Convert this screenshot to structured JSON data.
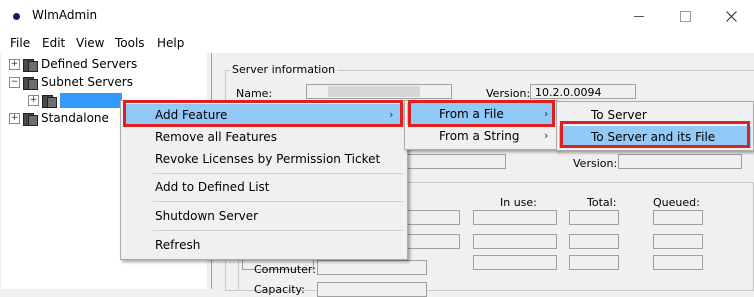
{
  "window": {
    "title": "WlmAdmin"
  },
  "menubar": [
    "File",
    "Edit",
    "View",
    "Tools",
    "Help"
  ],
  "tree": {
    "defined_servers": "Defined Servers",
    "subnet_servers": "Subnet Servers",
    "standalone": "Standalone",
    "expander": "+"
  },
  "server_info": {
    "group_label": "Server information",
    "name_label": "Name:",
    "version_label": "Version:",
    "version_value": "10.2.0.0094",
    "version_label_2": "Version:"
  },
  "feature_table": {
    "in_use": "In use:",
    "total": "Total:",
    "queued": "Queued:",
    "commuter": "Commuter:",
    "capacity": "Capacity:"
  },
  "context_menu": {
    "items": [
      "Add Feature",
      "Remove all Features",
      "Revoke Licenses by Permission Ticket",
      "Add to Defined List",
      "Shutdown Server",
      "Refresh"
    ],
    "arrow": "›"
  },
  "submenu_add_feature": {
    "items": [
      "From a File",
      "From a String"
    ],
    "arrow": "›"
  },
  "submenu_from_file": {
    "items": [
      "To Server",
      "To Server and its File"
    ]
  },
  "colors": {
    "highlight": "#91c9f7",
    "annotation_red": "#e02020",
    "tree_selection": "#3399ff"
  }
}
